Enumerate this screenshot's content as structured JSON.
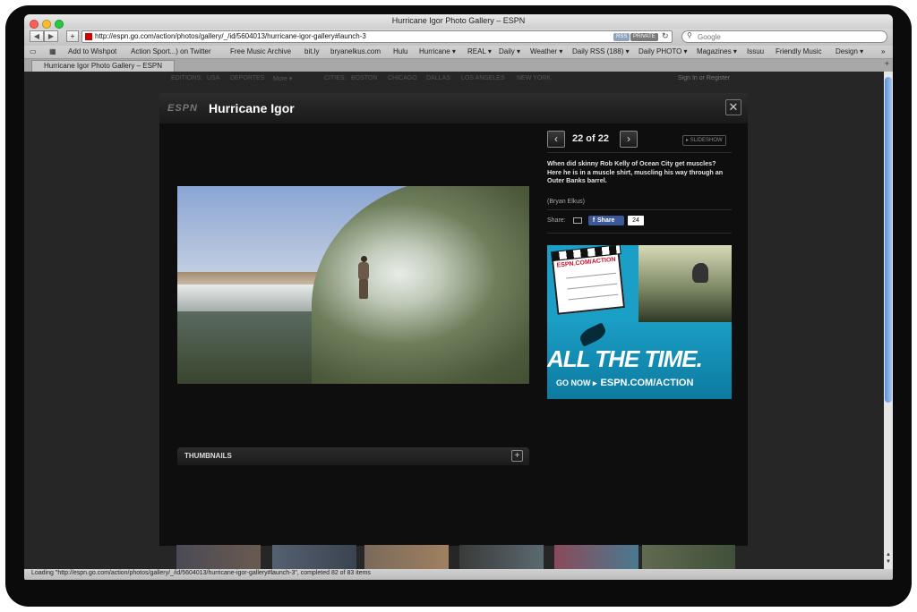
{
  "window": {
    "title": "Hurricane Igor Photo Gallery – ESPN"
  },
  "toolbar": {
    "url": "http://espn.go.com/action/photos/gallery/_/id/5604013/hurricane-igor-gallery#launch-3",
    "rss": "RSS",
    "private": "PRIVATE",
    "search_placeholder": "Google"
  },
  "bookmarks": [
    "Add to Wishpot",
    "Action Sport...) on Twitter",
    "Free Music Archive",
    "bit.ly",
    "bryanelkus.com",
    "Hulu",
    "Hurricane ▾",
    "REAL ▾",
    "Daily ▾",
    "Weather ▾",
    "Daily RSS (188) ▾",
    "Daily PHOTO ▾",
    "Magazines ▾",
    "Issuu",
    "Friendly Music",
    "Design ▾"
  ],
  "tab": {
    "label": "Hurricane Igor Photo Gallery – ESPN"
  },
  "espnbar": {
    "editions": "EDITIONS:",
    "usa": "USA",
    "deportes": "DEPORTES",
    "more": "More ▾",
    "cities": "CITIES:",
    "boston": "BOSTON",
    "chicago": "CHICAGO",
    "dallas": "DALLAS",
    "la": "LOS ANGELES",
    "ny": "NEW YORK",
    "signin": "Sign In or Register"
  },
  "gallery": {
    "logo": "ESPN",
    "title": "Hurricane Igor",
    "counter": "22 of 22",
    "slideshow": "▸ SLIDESHOW",
    "caption": "When did skinny Rob Kelly of Ocean City get muscles? Here he is in a muscle shirt, muscling his way through an Outer Banks barrel.",
    "credit": "(Bryan Elkus)",
    "share_label": "Share:",
    "fb_share": "Share",
    "fb_count": "24",
    "thumbnails": "THUMBNAILS"
  },
  "ad": {
    "clap_brand": "ESPN.COM/ACTION",
    "big_text": "ALL THE TIME.",
    "go_now": "GO NOW ▸",
    "brand": "ESPN.COM/ACTION"
  },
  "status": {
    "text": "Loading \"http://espn.go.com/action/photos/gallery/_/id/5604013/hurricane-igor-gallery#launch-3\", completed 82 of 83 items"
  }
}
